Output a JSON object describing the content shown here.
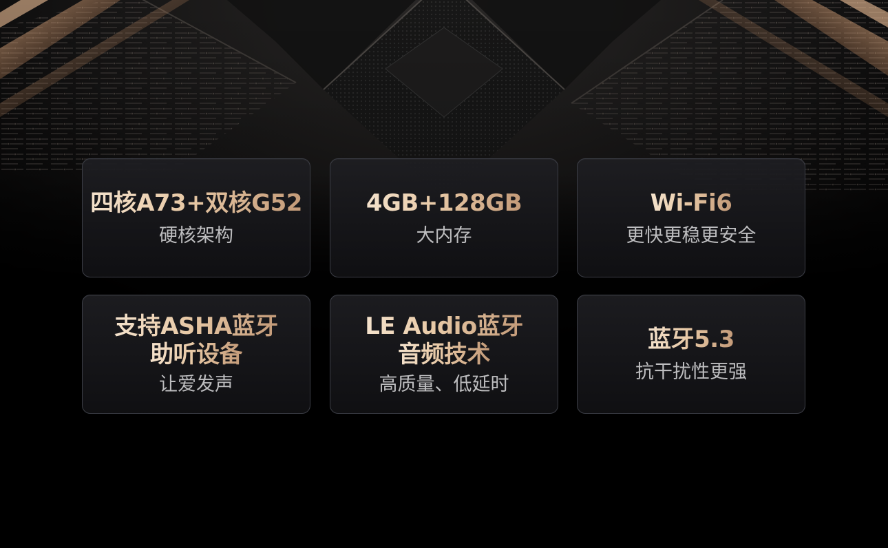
{
  "colors": {
    "background": "#000000",
    "card_border": "#3c3e46",
    "title_gradient_start": "#f4e2cc",
    "title_gradient_end": "#c39a78",
    "subtitle": "#bdbdbf",
    "accent_glow": "#d9905c"
  },
  "cards": [
    {
      "title_lines": [
        "四核A73+双核G52"
      ],
      "subtitle": "硬核架构"
    },
    {
      "title_lines": [
        "4GB+128GB"
      ],
      "subtitle": "大内存"
    },
    {
      "title_lines": [
        "Wi-Fi6"
      ],
      "subtitle": "更快更稳更安全"
    },
    {
      "title_lines": [
        "支持ASHA蓝牙",
        "助听设备"
      ],
      "subtitle": "让爱发声"
    },
    {
      "title_lines": [
        "LE Audio蓝牙",
        "音频技术"
      ],
      "subtitle": "高质量、低延时"
    },
    {
      "title_lines": [
        "蓝牙5.3"
      ],
      "subtitle": "抗干扰性更强"
    }
  ]
}
